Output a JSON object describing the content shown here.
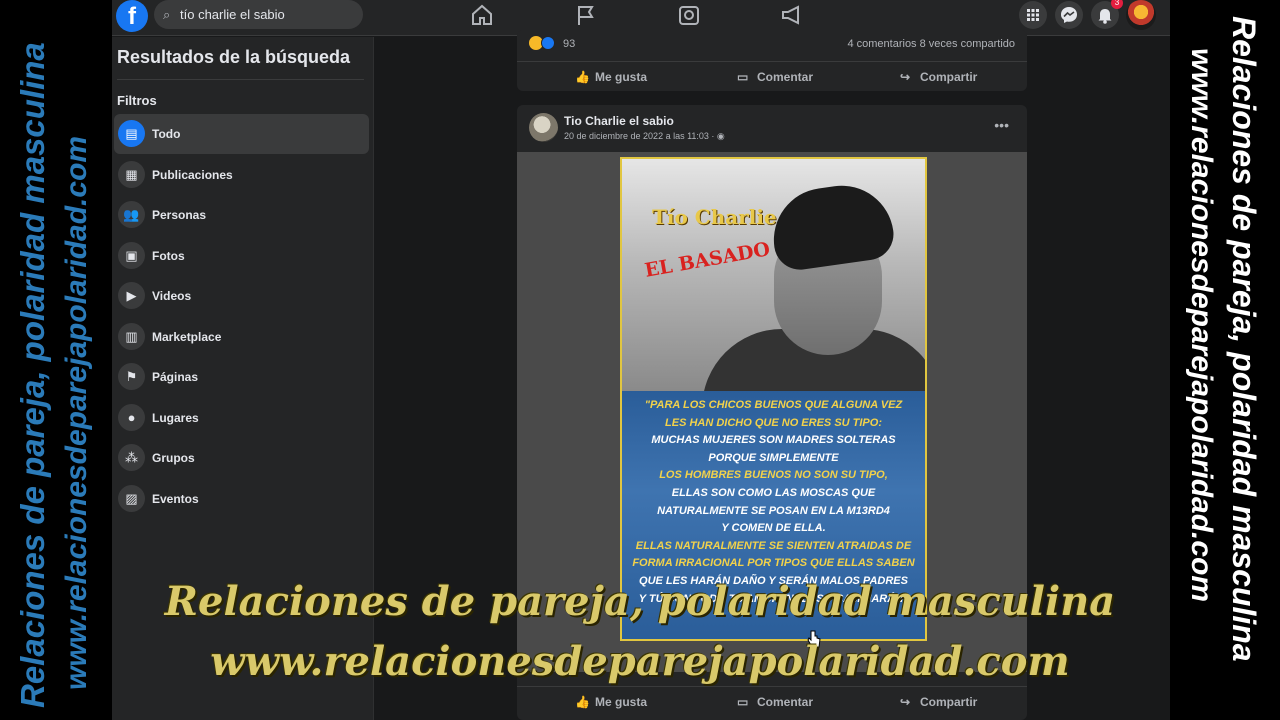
{
  "watermark": {
    "line1": "Relaciones de pareja, polaridad masculina",
    "line2": "www.relacionesdeparejapolaridad.com"
  },
  "topbar": {
    "logo": "f",
    "search_value": "tío charlie el sabio",
    "notifications_badge": "3"
  },
  "sidebar": {
    "title": "Resultados de la búsqueda",
    "filters_label": "Filtros",
    "items": [
      {
        "label": "Todo",
        "icon": "▤"
      },
      {
        "label": "Publicaciones",
        "icon": "▦"
      },
      {
        "label": "Personas",
        "icon": "👥"
      },
      {
        "label": "Fotos",
        "icon": "▣"
      },
      {
        "label": "Videos",
        "icon": "▶"
      },
      {
        "label": "Marketplace",
        "icon": "▥"
      },
      {
        "label": "Páginas",
        "icon": "⚑"
      },
      {
        "label": "Lugares",
        "icon": "●"
      },
      {
        "label": "Grupos",
        "icon": "⁂"
      },
      {
        "label": "Eventos",
        "icon": "▨"
      }
    ]
  },
  "post1": {
    "reactions_count": "93",
    "stats": "4 comentarios  8 veces compartido",
    "like": "Me gusta",
    "comment": "Comentar",
    "share": "Compartir"
  },
  "post2": {
    "author": "Tio Charlie el sabio",
    "meta": "20 de diciembre de 2022 a las 11:03 · ◉",
    "image_title1": "Tío Charlie",
    "image_title2": "EL BASADO",
    "quote_lines": [
      "\"PARA LOS CHICOS BUENOS QUE ALGUNA VEZ",
      "LES HAN DICHO QUE NO ERES SU TIPO:",
      "MUCHAS MUJERES SON MADRES SOLTERAS",
      "PORQUE SIMPLEMENTE",
      "LOS HOMBRES BUENOS NO SON SU TIPO,",
      "ELLAS SON COMO LAS MOSCAS QUE",
      "NATURALMENTE SE POSAN EN LA M13RD4",
      "Y COMEN DE ELLA.",
      "ELLAS NATURALMENTE SE SIENTEN ATRAIDAS DE",
      "FORMA IRRACIONAL POR TIPOS QUE ELLAS SABEN",
      "QUE LES HARÁN DAÑO Y SERÁN MALOS PADRES",
      "Y TÚ CON TODO TU AMOR INCLUSO CAMBIARÁN\""
    ],
    "like": "Me gusta",
    "comment": "Comentar",
    "share": "Compartir"
  },
  "caption": {
    "line1": "Relaciones de pareja, polaridad masculina",
    "line2": "www.relacionesdeparejapolaridad.com"
  },
  "colors": {
    "fb_blue": "#1877f2",
    "bg": "#18191a",
    "card": "#242526",
    "caption_gold": "#d9c96a",
    "watermark_blue": "#2b7bb9"
  }
}
